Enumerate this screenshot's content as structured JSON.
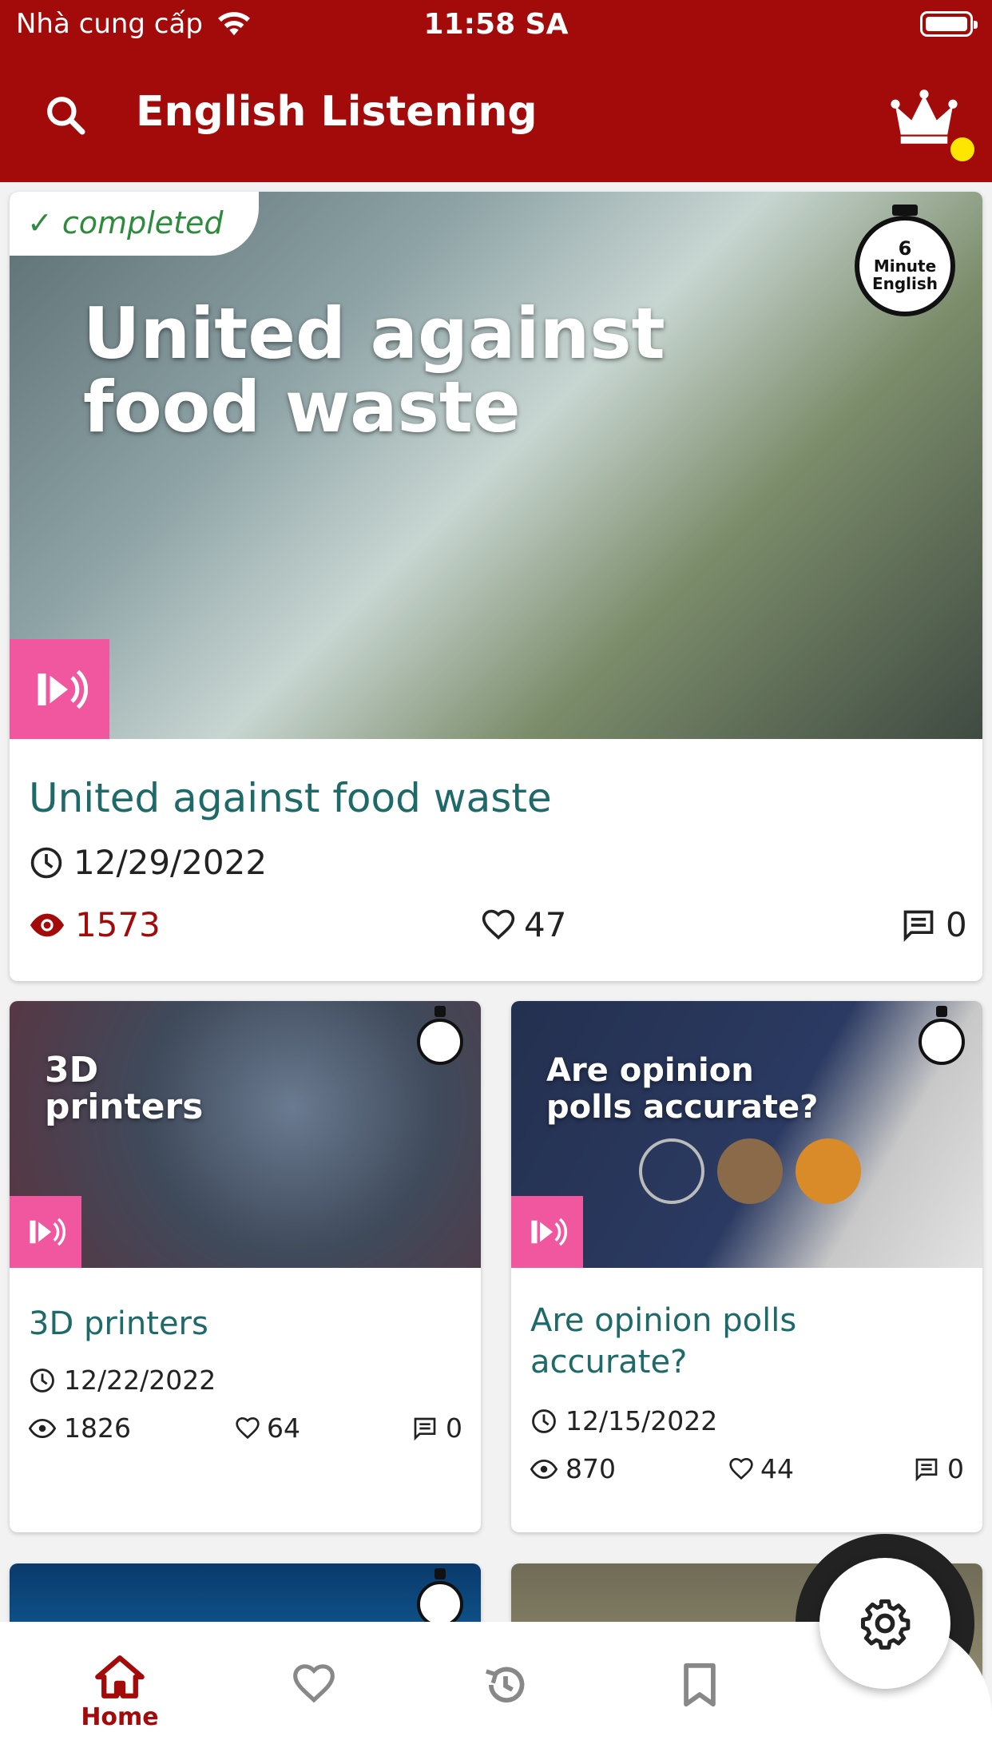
{
  "status_bar": {
    "carrier": "Nhà cung cấp",
    "time": "11:58 SA"
  },
  "app_bar": {
    "title": "English Listening"
  },
  "featured": {
    "completed_label": "✓ completed",
    "image_title_line1": "United against",
    "image_title_line2": "food waste",
    "timer_label": "Minute English",
    "timer_number": "6",
    "title": "United against food waste",
    "date": "12/29/2022",
    "views": "1573",
    "likes": "47",
    "comments": "0"
  },
  "grid": [
    {
      "image_title_line1": "3D",
      "image_title_line2": "printers",
      "title": "3D printers",
      "date": "12/22/2022",
      "views": "1826",
      "likes": "64",
      "comments": "0"
    },
    {
      "image_title_line1": "Are opinion",
      "image_title_line2": "polls accurate?",
      "title": "Are opinion polls accurate?",
      "date": "12/15/2022",
      "views": "870",
      "likes": "44",
      "comments": "0"
    }
  ],
  "bottom_nav": {
    "home_label": "Home"
  },
  "colors": {
    "brand": "#a30a0a",
    "title_teal": "#1e6a69",
    "badge_pink": "#f1579f",
    "notification": "#ffe600"
  }
}
